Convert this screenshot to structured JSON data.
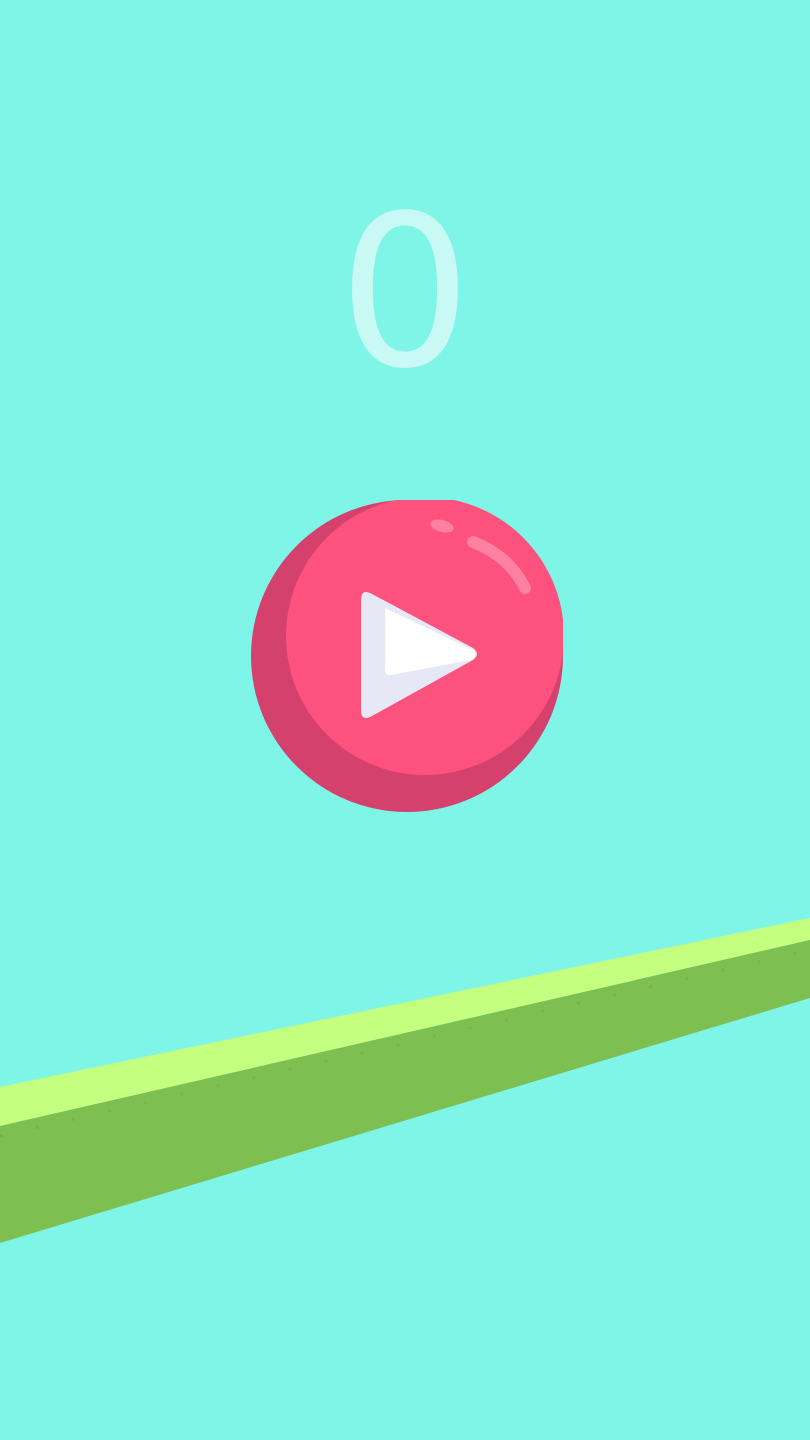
{
  "score": {
    "value": "0"
  },
  "play_button": {
    "icon": "play-icon"
  },
  "colors": {
    "sky": "#7ff5e7",
    "score_text": "#c8f9f4",
    "button_main": "#fd527e",
    "button_shadow": "#d5416d",
    "play_triangle_light": "#ffffff",
    "play_triangle_shade": "#e6e9f5",
    "ground_top": "#c5ff80",
    "ground_side": "#7ebf52"
  }
}
